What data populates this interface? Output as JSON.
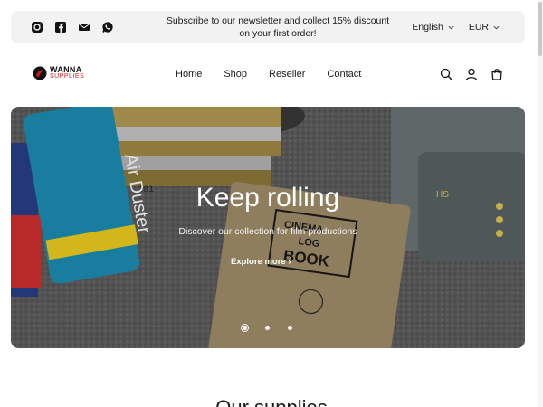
{
  "announcement": {
    "text": "Subscribe to our newsletter and collect 15% discount on your first order!",
    "social": [
      "instagram-icon",
      "facebook-icon",
      "email-icon",
      "whatsapp-icon"
    ]
  },
  "locale": {
    "language": "English",
    "currency": "EUR"
  },
  "brand": {
    "name_top": "WANNA",
    "name_bottom": "SUPPLIES",
    "accent": "#d21c1c"
  },
  "nav": {
    "items": [
      "Home",
      "Shop",
      "Reseller",
      "Contact"
    ]
  },
  "header_icons": [
    "search-icon",
    "account-icon",
    "cart-icon"
  ],
  "hero": {
    "title": "Keep rolling",
    "subtitle": "Discover our collection for film productions",
    "cta": "Explore more",
    "slide_count": 3,
    "active_slide": 1,
    "can_text": "Air Duster",
    "book_line1": "CINEMA",
    "book_line2": "LOG",
    "book_line3": "BOOK",
    "reel_label": "201",
    "case_label": "HS"
  },
  "next_section": {
    "title_partial": "Our supplies"
  }
}
